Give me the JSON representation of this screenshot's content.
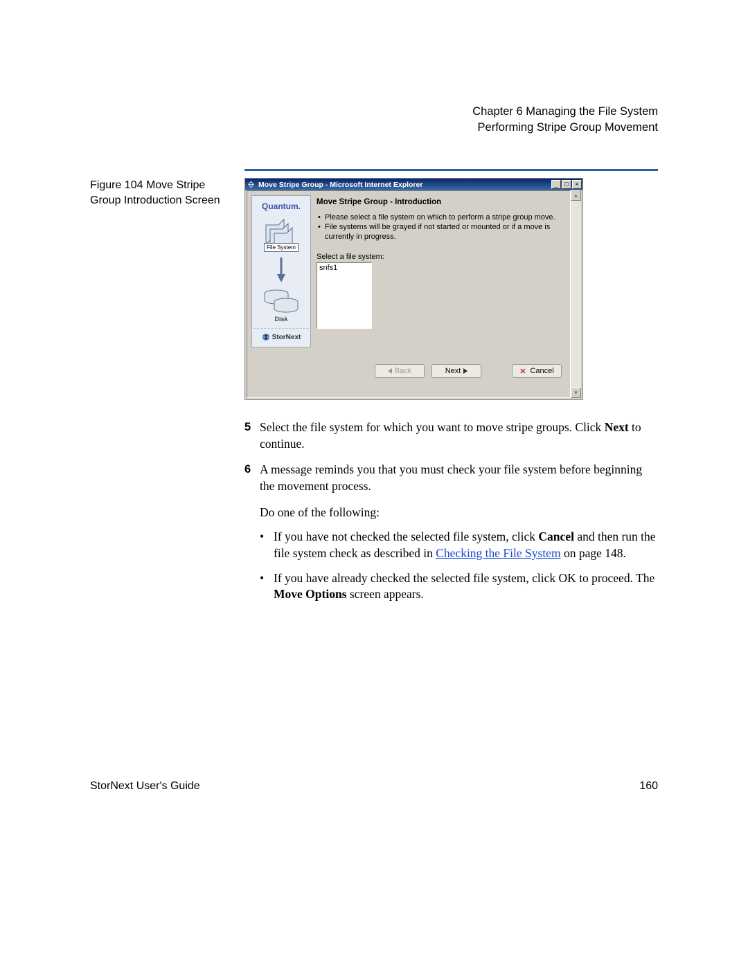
{
  "header": {
    "line1": "Chapter 6  Managing the File System",
    "line2": "Performing Stripe Group Movement"
  },
  "figure": {
    "caption": "Figure 104  Move Stripe Group Introduction Screen"
  },
  "screenshot": {
    "window_title": "Move Stripe Group - Microsoft Internet Explorer",
    "side": {
      "brand": "Quantum.",
      "fs_label": "File System",
      "disk_label": "Disk",
      "product": "StorNext"
    },
    "intro_title": "Move Stripe Group - Introduction",
    "bullet1": "Please select a file system on which to perform a stripe group move.",
    "bullet2": "File systems will be grayed if not started or mounted or if a move is currently in progress.",
    "select_label": "Select a file system:",
    "list_item": "snfs1",
    "buttons": {
      "back": "Back",
      "next": "Next",
      "cancel": "Cancel"
    }
  },
  "steps": {
    "s5_num": "5",
    "s5_a": "Select the file system for which you want to move stripe groups. Click ",
    "s5_next": "Next",
    "s5_b": " to continue.",
    "s6_num": "6",
    "s6": "A message reminds you that you must check your file system before beginning the movement process.",
    "do_one": "Do one of the following:",
    "b1_a": "If you have not checked the selected file system, click ",
    "b1_cancel": "Cancel",
    "b1_b": " and then run the file system check as described in ",
    "b1_link": "Checking the File System",
    "b1_c": " on page  148.",
    "b2_a": "If you have already checked the selected file system, click OK to proceed. The ",
    "b2_move": "Move Options",
    "b2_b": " screen appears."
  },
  "footer": {
    "left": "StorNext User's Guide",
    "right": "160"
  }
}
